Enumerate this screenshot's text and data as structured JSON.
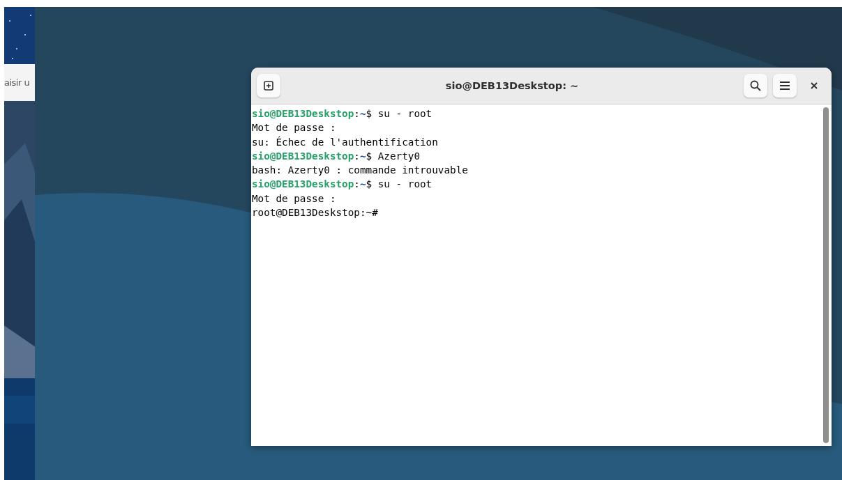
{
  "background_window": {
    "field": {
      "value": "aisir u"
    }
  },
  "terminal": {
    "title": "sio@DEB13Deskstop: ~",
    "lines": [
      {
        "kind": "prompt",
        "user": "sio@DEB13Deskstop",
        "separator": ":",
        "path": "~",
        "command": "$ su - root"
      },
      {
        "kind": "output",
        "text": "Mot de passe :"
      },
      {
        "kind": "output",
        "text": "su: Échec de l'authentification"
      },
      {
        "kind": "prompt",
        "user": "sio@DEB13Deskstop",
        "separator": ":",
        "path": "~",
        "command": "$ Azerty0"
      },
      {
        "kind": "output",
        "text": "bash: Azerty0 : commande introuvable"
      },
      {
        "kind": "prompt",
        "user": "sio@DEB13Deskstop",
        "separator": ":",
        "path": "~",
        "command": "$ su - root"
      },
      {
        "kind": "output",
        "text": "Mot de passe :"
      },
      {
        "kind": "output",
        "text": "root@DEB13Deskstop:~#"
      }
    ]
  }
}
